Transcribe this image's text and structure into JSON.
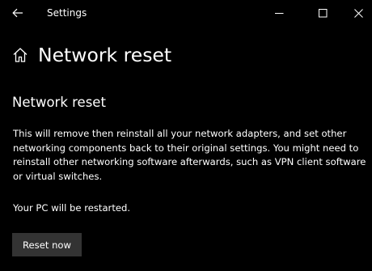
{
  "window": {
    "title": "Settings"
  },
  "header": {
    "page_title": "Network reset",
    "home_icon": "home-icon"
  },
  "content": {
    "section_title": "Network reset",
    "description": "This will remove then reinstall all your network adapters, and set other networking components back to their original settings. You might need to reinstall other networking software afterwards, such as VPN client software or virtual switches.",
    "restart_note": "Your PC will be restarted.",
    "reset_button_label": "Reset now"
  },
  "colors": {
    "background": "#000000",
    "text": "#ffffff",
    "button_background": "#333333"
  }
}
